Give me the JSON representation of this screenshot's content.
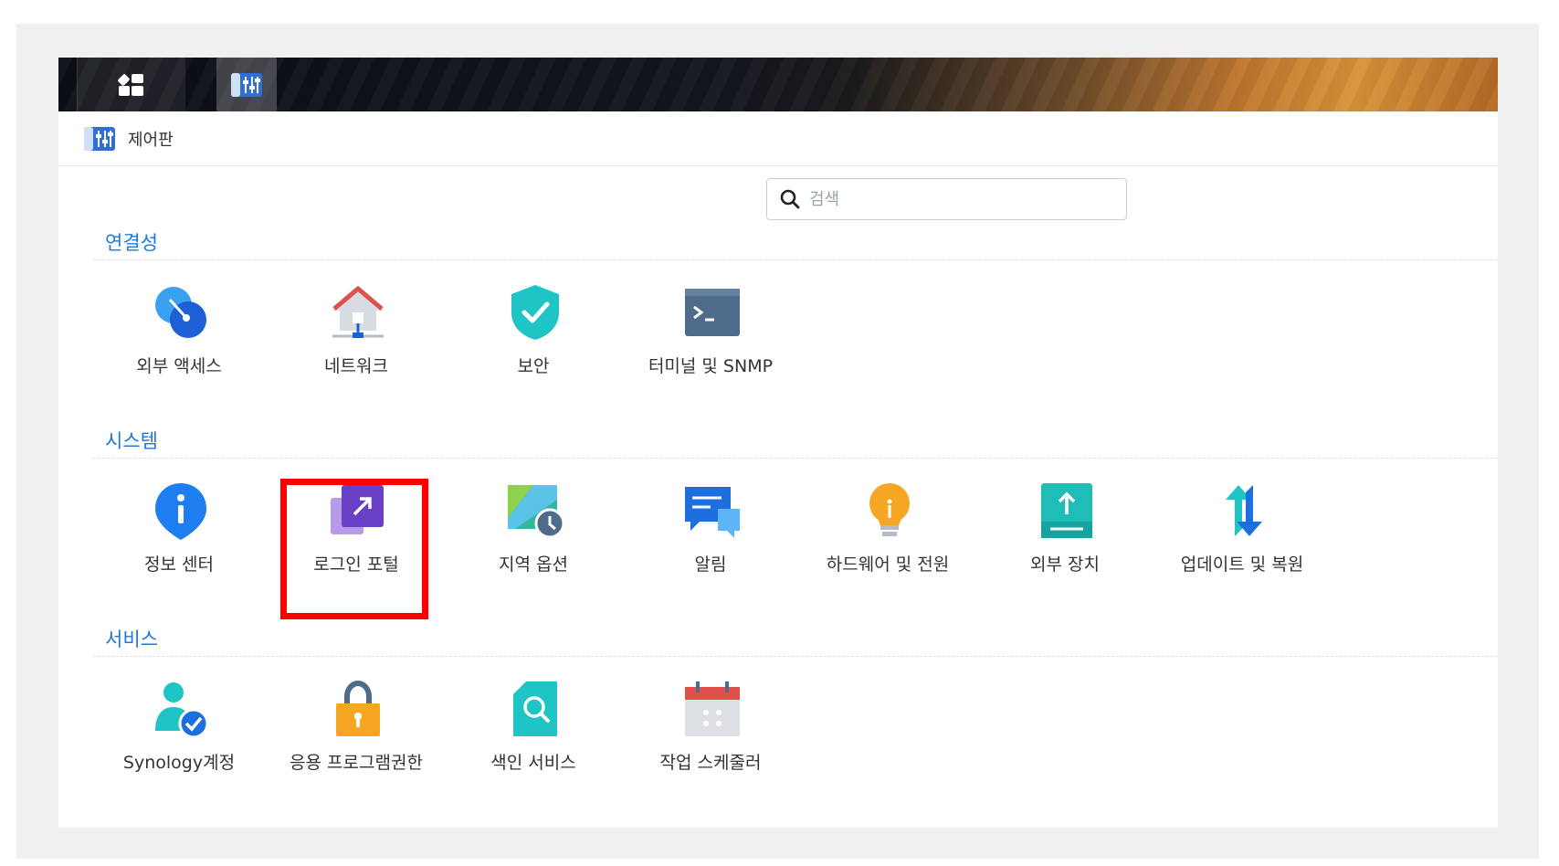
{
  "taskbar": {
    "apps_icon": "apps-grid-icon",
    "control_panel_icon": "control-panel-icon"
  },
  "window": {
    "title": "제어판",
    "title_icon": "control-panel-icon"
  },
  "search": {
    "placeholder": "검색",
    "value": ""
  },
  "sections": [
    {
      "title": "연결성",
      "items": [
        {
          "label": "외부 액세스",
          "icon": "external-access-icon"
        },
        {
          "label": "네트워크",
          "icon": "network-icon"
        },
        {
          "label": "보안",
          "icon": "security-shield-icon"
        },
        {
          "label": "터미널 및 SNMP",
          "icon": "terminal-icon"
        }
      ]
    },
    {
      "title": "시스템",
      "items": [
        {
          "label": "정보 센터",
          "icon": "info-center-icon"
        },
        {
          "label": "로그인 포털",
          "icon": "login-portal-icon"
        },
        {
          "label": "지역 옵션",
          "icon": "regional-options-icon"
        },
        {
          "label": "알림",
          "icon": "notification-icon"
        },
        {
          "label": "하드웨어 및 전원",
          "icon": "hardware-power-icon"
        },
        {
          "label": "외부 장치",
          "icon": "external-devices-icon"
        },
        {
          "label": "업데이트 및 복원",
          "icon": "update-restore-icon"
        }
      ]
    },
    {
      "title": "서비스",
      "items": [
        {
          "label": "Synology계정",
          "icon": "synology-account-icon"
        },
        {
          "label": "응용 프로그램권한",
          "icon": "application-privileges-icon"
        },
        {
          "label": "색인 서비스",
          "icon": "indexing-service-icon"
        },
        {
          "label": "작업 스케줄러",
          "icon": "task-scheduler-icon"
        }
      ]
    }
  ],
  "highlight": {
    "target": "로그인 포털",
    "color": "#ff0000"
  },
  "colors": {
    "section_title": "#1e78d7",
    "accent_blue": "#1e78d7"
  }
}
